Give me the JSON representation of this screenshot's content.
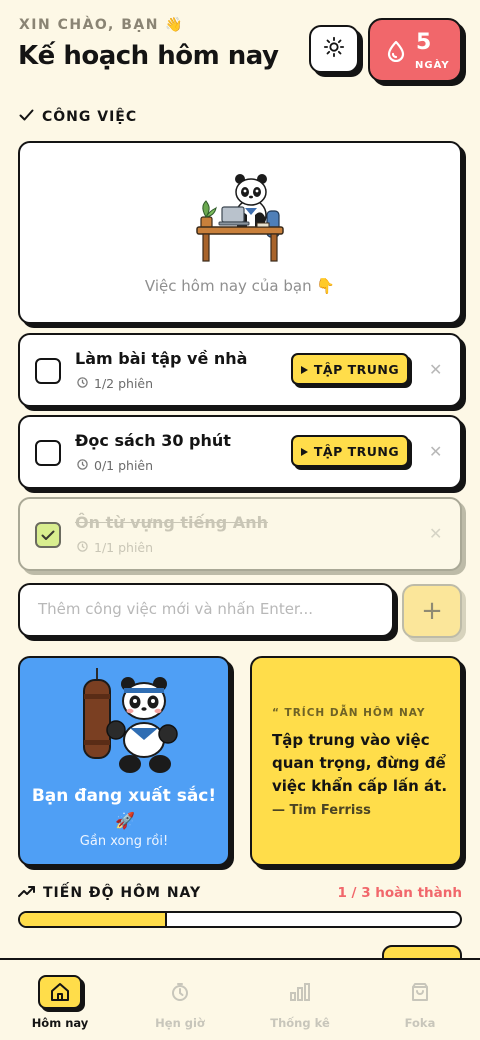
{
  "header": {
    "greeting": "XIN CHÀO, BẠN 👋",
    "title": "Kế hoạch hôm nay",
    "theme_icon": "sun-icon",
    "streak": {
      "value": "5",
      "unit": "NGÀY",
      "icon": "drop-icon"
    }
  },
  "tasks_section": {
    "label": "CÔNG VIỆC",
    "hero_caption": "Việc hôm nay của bạn 👇",
    "items": [
      {
        "name": "Làm bài tập về nhà",
        "sessions": "1/2 phiên",
        "focus_label": "TẬP TRUNG",
        "done": false
      },
      {
        "name": "Đọc sách 30 phút",
        "sessions": "0/1 phiên",
        "focus_label": "TẬP TRUNG",
        "done": false
      },
      {
        "name": "Ôn từ vựng tiếng Anh",
        "sessions": "1/1 phiên",
        "done": true
      }
    ],
    "add_placeholder": "Thêm công việc mới và nhấn Enter...",
    "add_button": "+"
  },
  "motivation": {
    "headline": "Bạn đang xuất sắc!",
    "emoji": "🚀",
    "subtext": "Gần xong rồi!"
  },
  "quote": {
    "label": "“ TRÍCH DẪN HÔM NAY",
    "text": "Tập trung vào việc quan trọng, đừng để việc khẩn cấp lấn át.",
    "author": "— Tim Ferriss"
  },
  "progress": {
    "label": "TIẾN ĐỘ HÔM NAY",
    "summary": "1 / 3 hoàn thành",
    "fraction": 0.333
  },
  "nav": {
    "items": [
      {
        "label": "Hôm nay",
        "icon": "home-icon",
        "active": true
      },
      {
        "label": "Hẹn giờ",
        "icon": "timer-icon",
        "active": false
      },
      {
        "label": "Thống kê",
        "icon": "chart-icon",
        "active": false
      },
      {
        "label": "Foka",
        "icon": "bag-icon",
        "active": false
      }
    ]
  },
  "colors": {
    "background": "#fdf8e6",
    "accent_yellow": "#ffdd4a",
    "accent_red": "#f1676b",
    "accent_blue": "#4f9ff5",
    "ink": "#141414"
  }
}
